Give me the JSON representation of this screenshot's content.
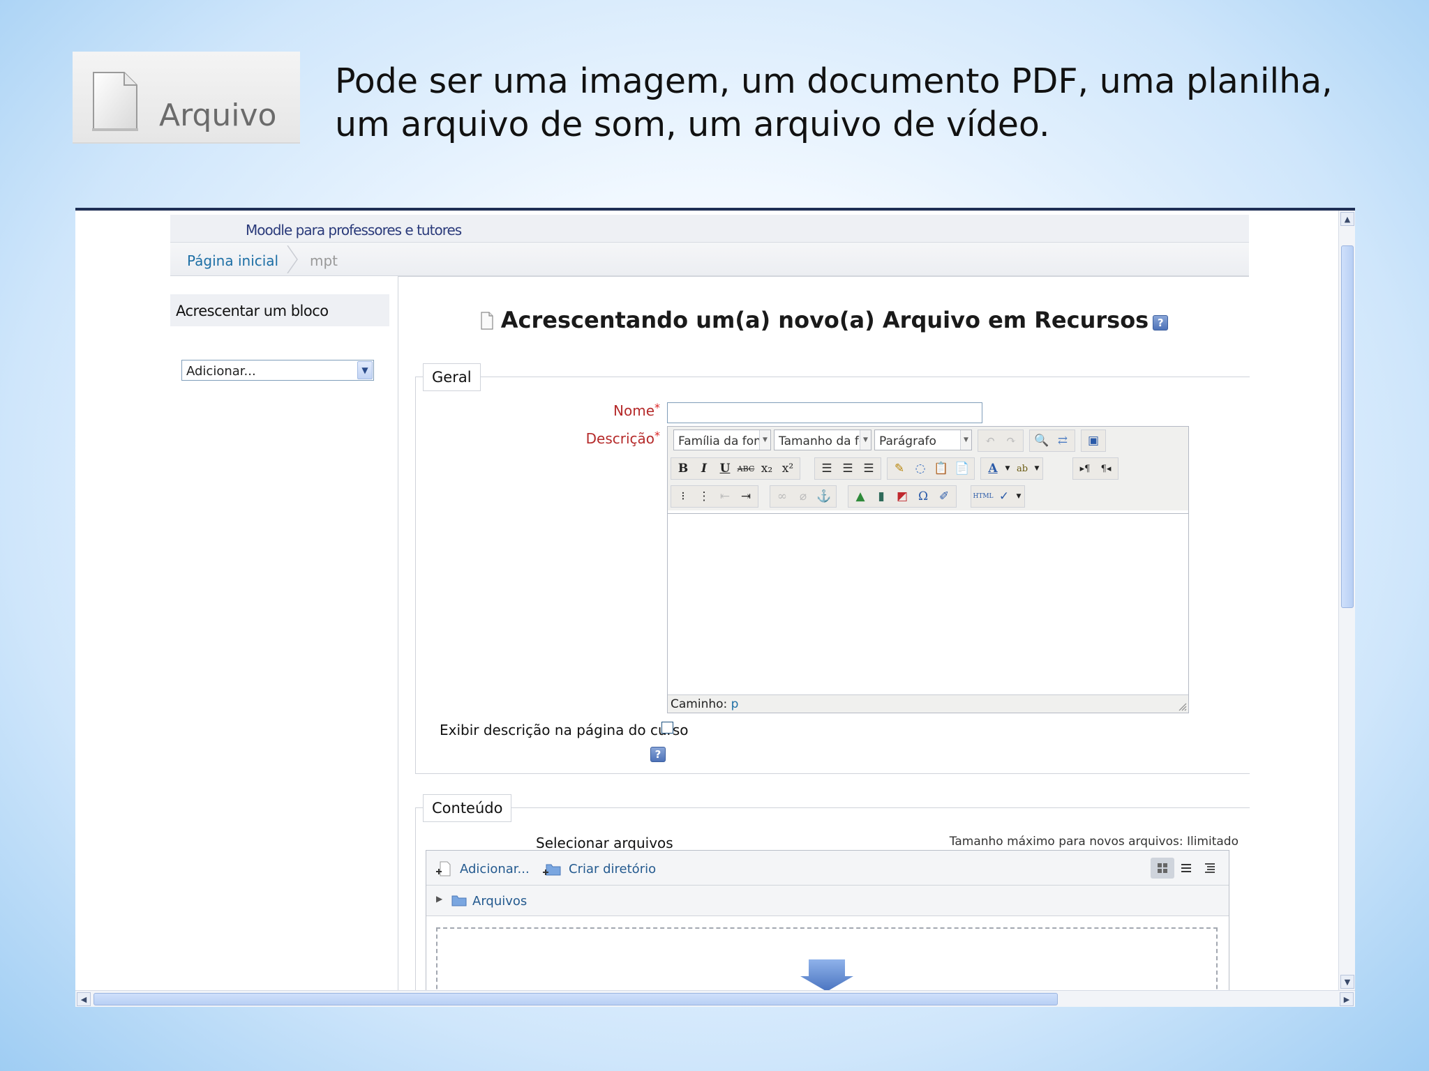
{
  "slide": {
    "badge_label": "Arquivo",
    "description": "Pode ser uma imagem, um documento PDF, uma planilha, um arquivo de som, um arquivo de vídeo."
  },
  "site": {
    "name": "Moodle para professores e tutores",
    "breadcrumb": {
      "home": "Página inicial",
      "current": "mpt"
    }
  },
  "left_block": {
    "title": "Acrescentar um bloco",
    "select_value": "Adicionar..."
  },
  "form": {
    "title": "Acrescentando um(a) novo(a) Arquivo em Recursos",
    "general": {
      "legend": "Geral",
      "name_label": "Nome",
      "description_label": "Descrição",
      "name_value": "",
      "editor": {
        "font_family": "Família da font",
        "font_size": "Tamanho da fc",
        "format": "Parágrafo",
        "path_label": "Caminho:",
        "path_value": "p"
      },
      "show_description_label": "Exibir descrição na página do curso"
    },
    "content": {
      "legend": "Conteúdo",
      "select_files_label": "Selecionar arquivos",
      "max_size_text": "Tamanho máximo para novos arquivos: Ilimitado",
      "add_label": "Adicionar...",
      "create_dir_label": "Criar diretório",
      "folder_label": "Arquivos"
    }
  },
  "colors": {
    "accent_link": "#1d6fa5",
    "required_label": "#b52a2a",
    "header_navy": "#1f2f55"
  }
}
